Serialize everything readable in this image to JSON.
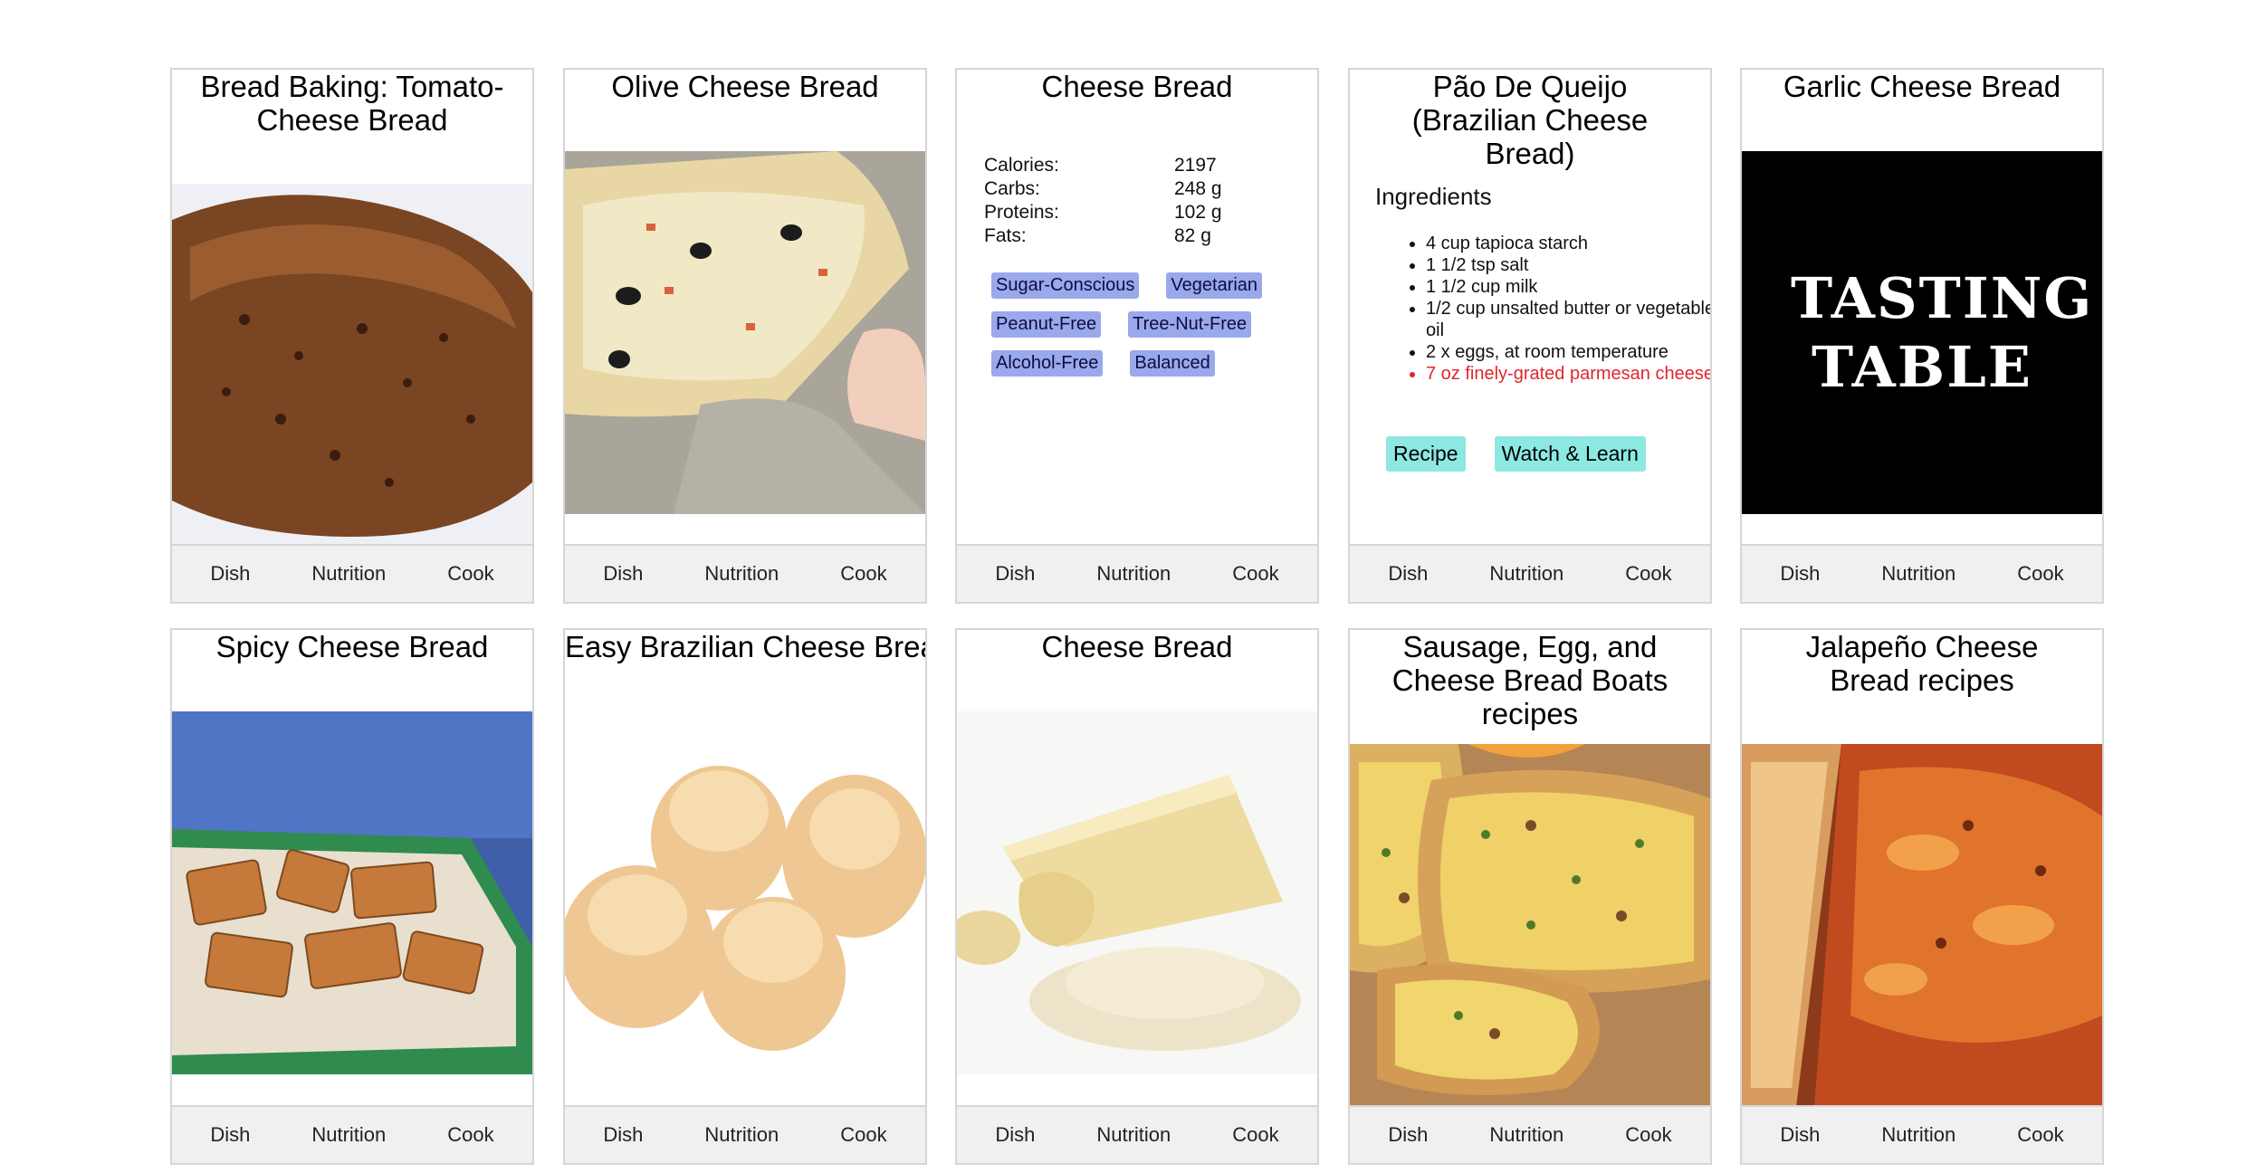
{
  "footer_tabs": [
    "Dish",
    "Nutrition",
    "Cook"
  ],
  "cards": [
    {
      "title": "Bread Baking: Tomato-Cheese Bread"
    },
    {
      "title": "Olive Cheese Bread"
    },
    {
      "title": "Cheese Bread",
      "nutrition": [
        {
          "label": "Calories:",
          "value": "2197"
        },
        {
          "label": "Carbs:",
          "value": "248 g"
        },
        {
          "label": "Proteins:",
          "value": "102 g"
        },
        {
          "label": "Fats:",
          "value": "82 g"
        }
      ],
      "tags": [
        "Sugar-Conscious",
        "Vegetarian",
        "Peanut-Free",
        "Tree-Nut-Free",
        "Alcohol-Free",
        "Balanced"
      ]
    },
    {
      "title": "Pão De Queijo (Brazilian Cheese Bread)",
      "ingredients_heading": "Ingredients",
      "ingredients": [
        "4 cup tapioca starch",
        "1 1/2 tsp salt",
        "1 1/2 cup milk",
        "1/2 cup unsalted butter or vegetable oil",
        "2 x eggs, at room temperature",
        "7 oz finely-grated parmesan cheese"
      ],
      "buttons": [
        "Recipe",
        "Watch & Learn"
      ]
    },
    {
      "title": "Garlic Cheese Bread",
      "logo_text": "TASTING TABLE"
    },
    {
      "title": "Spicy Cheese Bread"
    },
    {
      "title": "Easy Brazilian Cheese Bread"
    },
    {
      "title": "Cheese Bread"
    },
    {
      "title": "Sausage, Egg, and Cheese Bread Boats recipes"
    },
    {
      "title": "Jalapeño Cheese Bread recipes"
    }
  ]
}
